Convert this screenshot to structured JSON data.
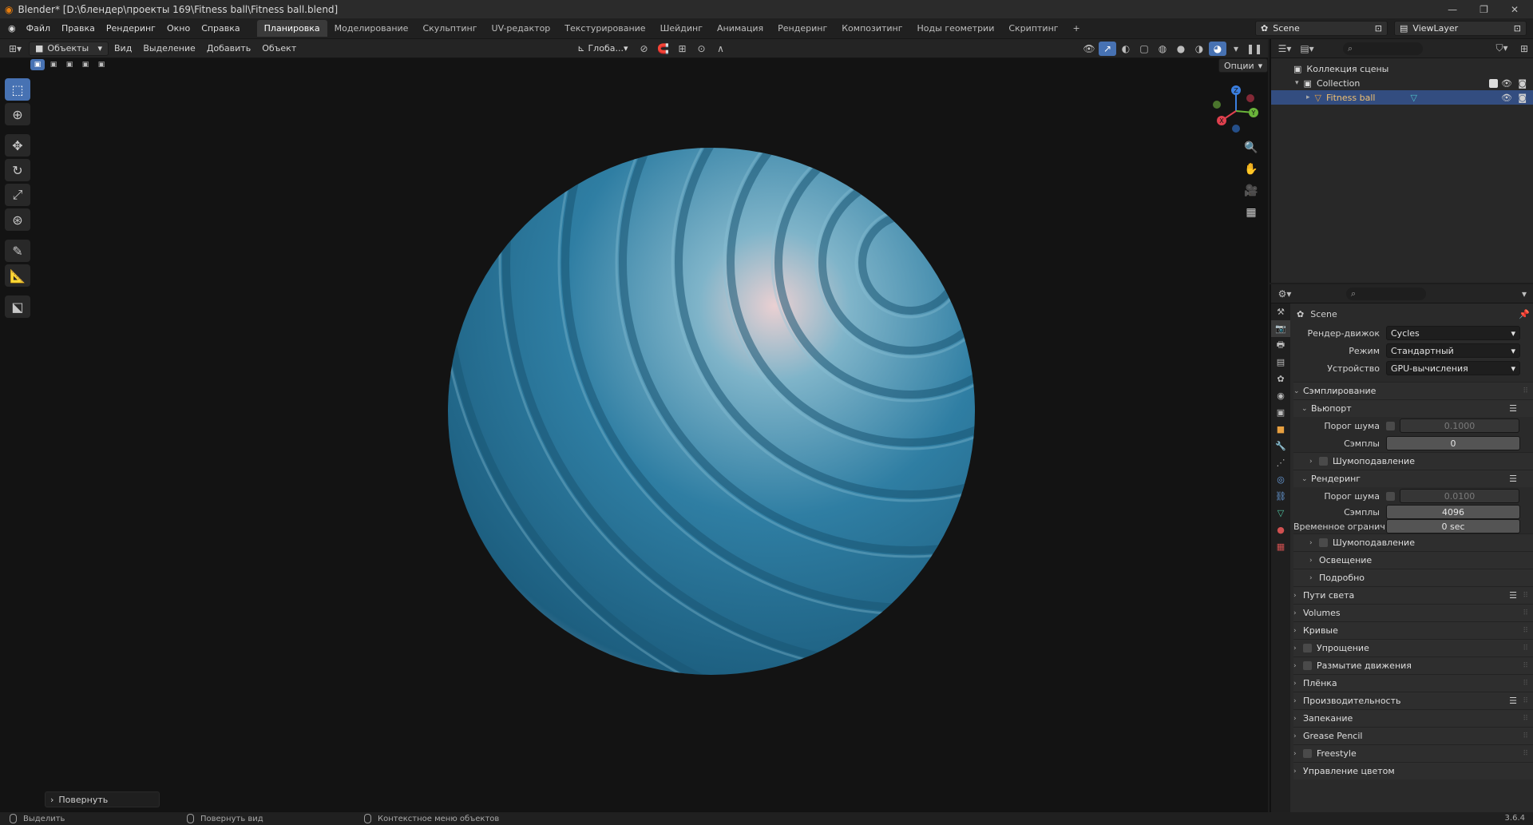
{
  "window": {
    "title": "Blender* [D:\\блендер\\проекты 169\\Fitness ball\\Fitness ball.blend]",
    "buttons": [
      "—",
      "❐",
      "✕"
    ]
  },
  "menu": [
    "Файл",
    "Правка",
    "Рендеринг",
    "Окно",
    "Справка"
  ],
  "workspaces": [
    "Планировка",
    "Моделирование",
    "Скульптинг",
    "UV-редактор",
    "Текстурирование",
    "Шейдинг",
    "Анимация",
    "Рендеринг",
    "Композитинг",
    "Ноды геометрии",
    "Скриптинг",
    "+"
  ],
  "scene_selector": "Scene",
  "viewlayer_selector": "ViewLayer",
  "viewport_header": {
    "mode": "Объекты",
    "items": [
      "Вид",
      "Выделение",
      "Добавить",
      "Объект"
    ],
    "transform": "Глоба..."
  },
  "options_label": "Опции",
  "redo_panel": "Повернуть",
  "outliner": {
    "search_placeholder": "",
    "rows": [
      "Коллекция сцены",
      "Collection",
      "Fitness ball"
    ]
  },
  "properties": {
    "context": "Scene",
    "fields": {
      "engine_label": "Рендер-движок",
      "engine": "Cycles",
      "mode_label": "Режим",
      "mode": "Стандартный",
      "device_label": "Устройство",
      "device": "GPU-вычисления"
    },
    "sampling": "Сэмплирование",
    "viewport": {
      "title": "Вьюпорт",
      "noise_label": "Порог шума",
      "noise": "0.1000",
      "samples_label": "Сэмплы",
      "samples": "0",
      "denoise": "Шумоподавление"
    },
    "render": {
      "title": "Рендеринг",
      "noise_label": "Порог шума",
      "noise": "0.0100",
      "samples_label": "Сэмплы",
      "samples": "4096",
      "time_label": "Временное огранич...",
      "time": "0 sec",
      "denoise": "Шумоподавление",
      "lights": "Освещение",
      "advanced": "Подробно"
    },
    "sections": [
      "Пути света",
      "Volumes",
      "Кривые",
      "Упрощение",
      "Размытие движения",
      "Плёнка",
      "Производительность",
      "Запекание",
      "Grease Pencil",
      "Freestyle",
      "Управление цветом"
    ]
  },
  "status": {
    "select": "Выделить",
    "rotate_view": "Повернуть вид",
    "context_menu": "Контекстное меню объектов",
    "version": "3.6.4"
  },
  "gizmo": {
    "x": "X",
    "y": "Y",
    "z": "Z"
  },
  "colors": {
    "accent": "#4772b3",
    "ball_blue": "#2f7ea3",
    "ball_pink": "#e8c4c8",
    "viewport_bg": "#131313"
  }
}
